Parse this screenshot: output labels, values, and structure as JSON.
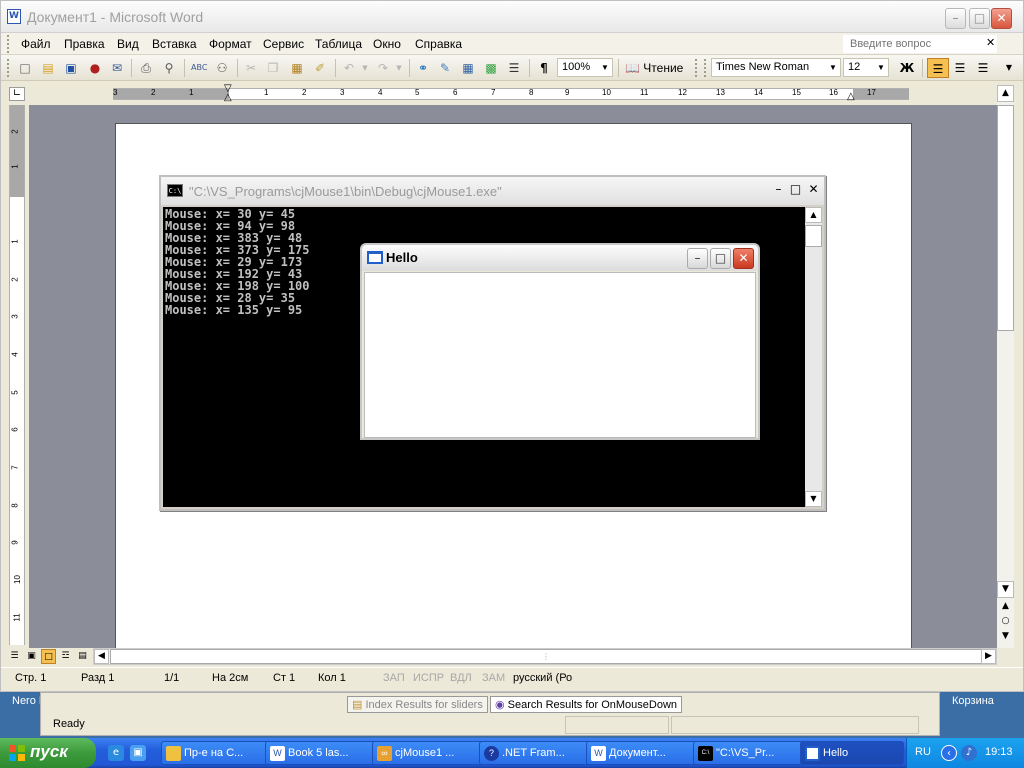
{
  "desktop": {
    "left_label": "Nero H",
    "right_label": "Корзина"
  },
  "word": {
    "title": "Документ1 - Microsoft Word",
    "menu": [
      "Файл",
      "Правка",
      "Вид",
      "Вставка",
      "Формат",
      "Сервис",
      "Таблица",
      "Окно",
      "Справка"
    ],
    "help_placeholder": "Введите вопрос",
    "zoom": "100%",
    "reading_label": "Чтение",
    "font_name": "Times New Roman",
    "font_size": "12",
    "bold_label": "Ж",
    "ruler_numbers": [
      "3",
      "2",
      "1",
      "1",
      "2",
      "3",
      "4",
      "5",
      "6",
      "7",
      "8",
      "9",
      "10",
      "11",
      "12",
      "13",
      "14",
      "15",
      "16",
      "17"
    ],
    "vruler_numbers": [
      "2",
      "1",
      "1",
      "2",
      "3",
      "4",
      "5",
      "6",
      "7",
      "8",
      "9",
      "10",
      "11"
    ],
    "status": {
      "page": "Стр. 1",
      "section": "Разд 1",
      "pages": "1/1",
      "at": "На 2см",
      "line": "Ст 1",
      "column": "Кол 1",
      "rec": "ЗАП",
      "trk": "ИСПР",
      "ext": "ВДЛ",
      "ovr": "ЗАМ",
      "language": "русский (Ро"
    }
  },
  "console": {
    "title": "\"C:\\VS_Programs\\cjMouse1\\bin\\Debug\\cjMouse1.exe\"",
    "icon_text": "C:\\",
    "lines": [
      "Mouse: x= 30 y= 45",
      "Mouse: x= 94 y= 98",
      "Mouse: x= 383 y= 48",
      "Mouse: x= 373 y= 175",
      "Mouse: x= 29 y= 173",
      "Mouse: x= 192 y= 43",
      "Mouse: x= 198 y= 100",
      "Mouse: x= 28 y= 35",
      "Mouse: x= 135 y= 95"
    ]
  },
  "hello": {
    "title": "Hello"
  },
  "bg_window": {
    "tab1": "Index Results for sliders",
    "tab2": "Search Results for OnMouseDown",
    "status": "Ready"
  },
  "taskbar": {
    "start": "пуск",
    "tasks": [
      {
        "label": "Пр-е на C...",
        "icon": "folder"
      },
      {
        "label": "Book 5 las...",
        "icon": "word"
      },
      {
        "label": "cjMouse1 ...",
        "icon": "vs"
      },
      {
        "label": ".NET Fram...",
        "icon": "help"
      },
      {
        "label": "Докумeнт...",
        "icon": "word"
      },
      {
        "label": "\"C:\\VS_Pr...",
        "icon": "console"
      },
      {
        "label": "Hello",
        "icon": "window"
      }
    ],
    "language": "RU",
    "clock": "19:13"
  }
}
